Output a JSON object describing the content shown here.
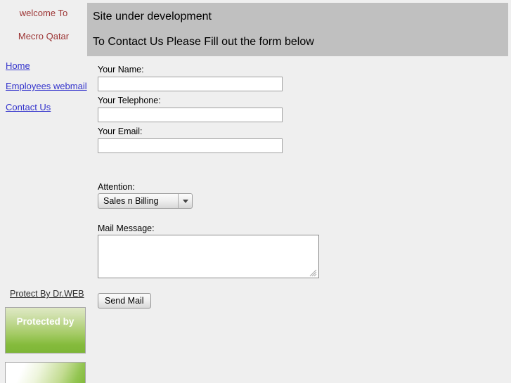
{
  "page": {
    "background_color": "#efefef"
  },
  "sidebar": {
    "welcome_lines": [
      "welcome To",
      "Mecro Qatar"
    ],
    "welcome_color": "#9c3434",
    "link_color": "#3333cc",
    "nav_items": [
      {
        "label": "Home"
      },
      {
        "label": "Employees webmail"
      },
      {
        "label": "Contact Us"
      }
    ],
    "protection": {
      "link_label": "Protect By Dr.WEB",
      "banner_label": "Protected by",
      "banner_color": "#85bb3c"
    }
  },
  "header": {
    "background_color": "#c0c0c0",
    "lines": [
      "Site under development",
      "To Contact Us Please Fill out the form below"
    ]
  },
  "form": {
    "fields": [
      {
        "label": "Your Name:",
        "value": "",
        "placeholder": ""
      },
      {
        "label": "Your Telephone:",
        "value": "",
        "placeholder": ""
      },
      {
        "label": "Your Email:",
        "value": "",
        "placeholder": ""
      }
    ],
    "attention": {
      "label": "Attention:",
      "selected": "Sales n Billing",
      "options": [
        "Sales n Billing"
      ]
    },
    "message": {
      "label": "Mail Message:",
      "value": "",
      "placeholder": ""
    },
    "submit": {
      "label": "Send Mail"
    }
  }
}
